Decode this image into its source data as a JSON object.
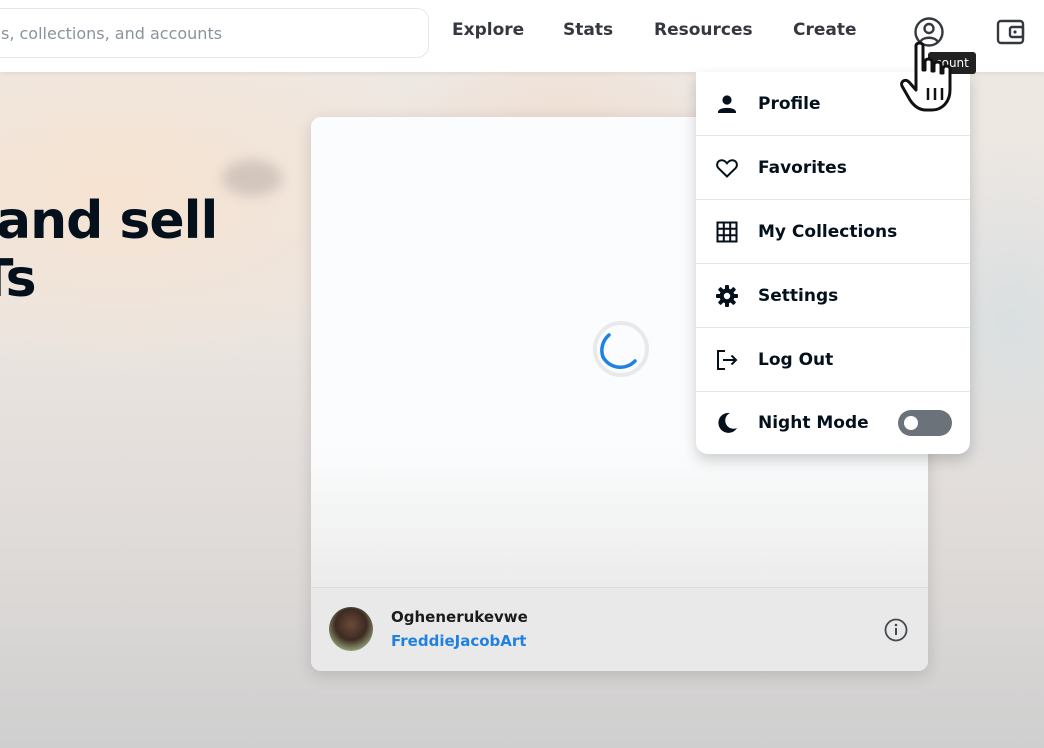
{
  "search": {
    "placeholder": "s, collections, and accounts"
  },
  "nav": {
    "links": [
      "Explore",
      "Stats",
      "Resources",
      "Create"
    ],
    "account_icon": "account-circle-icon",
    "wallet_icon": "wallet-icon"
  },
  "tooltip": {
    "text": "count"
  },
  "hero": {
    "line1": "and sell",
    "line2": "Ts"
  },
  "card": {
    "loading_icon": "spinner-icon",
    "creator_name": "Oghenerukevwe",
    "creator_handle": "FreddieJacobArt",
    "info_icon": "info-icon"
  },
  "menu": {
    "items": [
      {
        "label": "Profile",
        "icon": "person-icon"
      },
      {
        "label": "Favorites",
        "icon": "heart-icon"
      },
      {
        "label": "My Collections",
        "icon": "grid-icon"
      },
      {
        "label": "Settings",
        "icon": "gear-icon"
      },
      {
        "label": "Log Out",
        "icon": "logout-icon"
      },
      {
        "label": "Night Mode",
        "icon": "moon-icon"
      }
    ],
    "night_mode_on": false
  },
  "colors": {
    "link": "#2081e2",
    "text": "#04111d",
    "toggle_off": "#6b727a"
  }
}
